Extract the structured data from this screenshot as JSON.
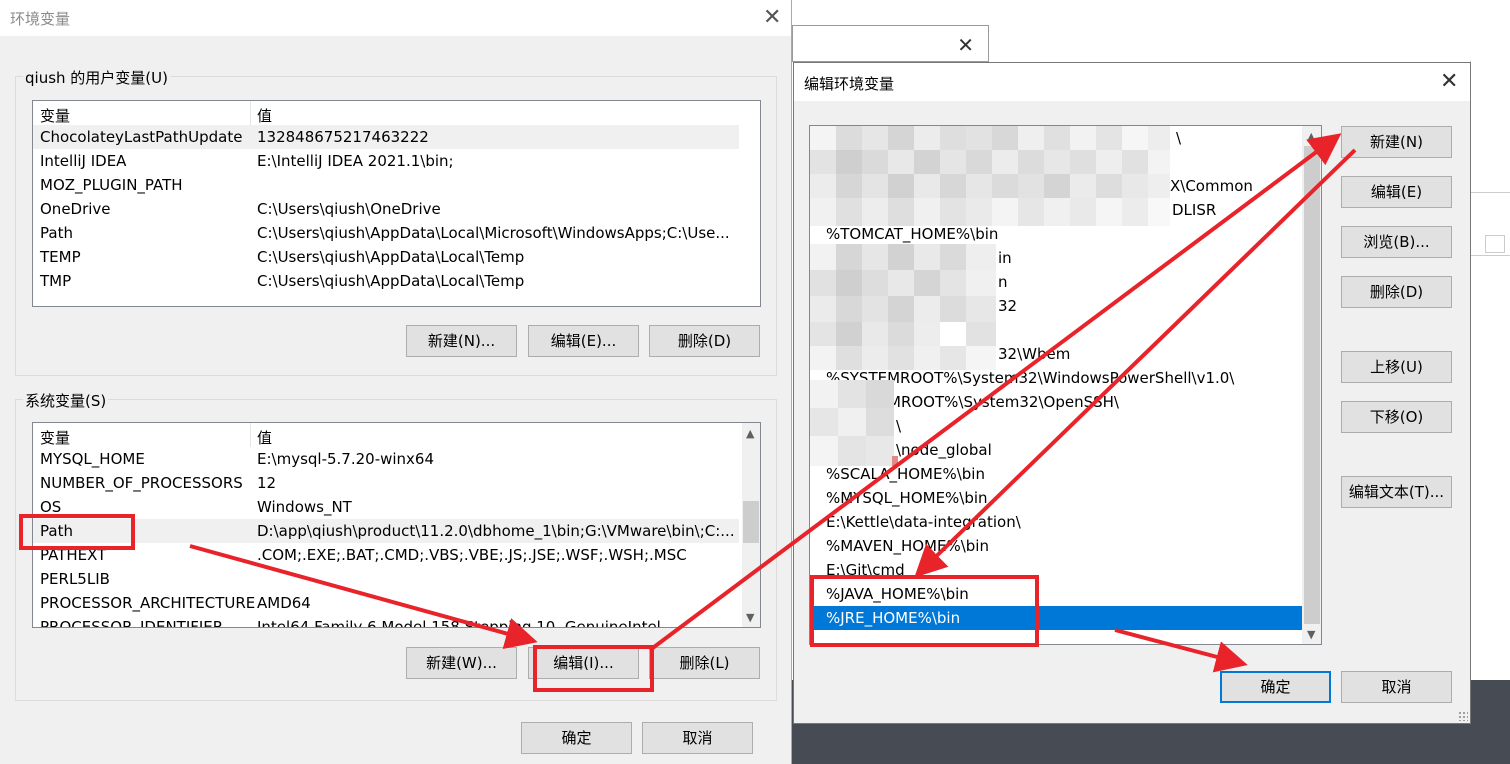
{
  "background": {
    "close_glyph": "✕"
  },
  "env_dialog": {
    "title": "环境变量",
    "close_glyph": "✕",
    "user_group_label": "qiush 的用户变量(U)",
    "user_columns": {
      "name": "变量",
      "value": "值"
    },
    "user_vars": [
      {
        "name": "ChocolateyLastPathUpdate",
        "value": "132848675217463222"
      },
      {
        "name": "IntelliJ IDEA",
        "value": "E:\\IntelliJ IDEA 2021.1\\bin;"
      },
      {
        "name": "MOZ_PLUGIN_PATH",
        "value": ""
      },
      {
        "name": "OneDrive",
        "value": "C:\\Users\\qiush\\OneDrive"
      },
      {
        "name": "Path",
        "value": "C:\\Users\\qiush\\AppData\\Local\\Microsoft\\WindowsApps;C:\\Use..."
      },
      {
        "name": "TEMP",
        "value": "C:\\Users\\qiush\\AppData\\Local\\Temp"
      },
      {
        "name": "TMP",
        "value": "C:\\Users\\qiush\\AppData\\Local\\Temp"
      }
    ],
    "user_buttons": {
      "new": "新建(N)...",
      "edit": "编辑(E)...",
      "delete": "删除(D)"
    },
    "system_group_label": "系统变量(S)",
    "system_columns": {
      "name": "变量",
      "value": "值"
    },
    "system_vars": [
      {
        "name": "MYSQL_HOME",
        "value": "E:\\mysql-5.7.20-winx64"
      },
      {
        "name": "NUMBER_OF_PROCESSORS",
        "value": "12"
      },
      {
        "name": "OS",
        "value": "Windows_NT"
      },
      {
        "name": "Path",
        "value": "D:\\app\\qiush\\product\\11.2.0\\dbhome_1\\bin;G:\\VMware\\bin\\;C:..."
      },
      {
        "name": "PATHEXT",
        "value": ".COM;.EXE;.BAT;.CMD;.VBS;.VBE;.JS;.JSE;.WSF;.WSH;.MSC"
      },
      {
        "name": "PERL5LIB",
        "value": ""
      },
      {
        "name": "PROCESSOR_ARCHITECTURE",
        "value": "AMD64"
      },
      {
        "name": "PROCESSOR_IDENTIFIER",
        "value": "Intel64 Family 6 Model 158 Stepping 10, GenuineIntel"
      }
    ],
    "system_buttons": {
      "new": "新建(W)...",
      "edit": "编辑(I)...",
      "delete": "删除(L)"
    },
    "ok": "确定",
    "cancel": "取消"
  },
  "edit_dialog": {
    "title": "编辑环境变量",
    "close_glyph": "✕",
    "path_entries": [
      "\\",
      "",
      "X\\Common",
      "DLISR",
      "%TOMCAT_HOME%\\bin",
      "in",
      "n",
      "32",
      "",
      "32\\Wbem",
      "%SYSTEMROOT%\\System32\\WindowsPowerShell\\v1.0\\",
      "MROOT%\\System32\\OpenSSH\\",
      "\\",
      "\\node_global",
      "%SCALA_HOME%\\bin",
      "%MYSQL_HOME%\\bin",
      "E:\\Kettle\\data-integration\\",
      "%MAVEN_HOME%\\bin",
      "E:\\Git\\cmd",
      "%JAVA_HOME%\\bin",
      "%JRE_HOME%\\bin"
    ],
    "selected_entry": "%JRE_HOME%\\bin",
    "buttons": {
      "new": "新建(N)",
      "edit": "编辑(E)",
      "browse": "浏览(B)...",
      "delete": "删除(D)",
      "move_up": "上移(U)",
      "move_down": "下移(O)",
      "edit_text": "编辑文本(T)..."
    },
    "ok": "确定",
    "cancel": "取消"
  },
  "annotation_color": "#e8232a"
}
